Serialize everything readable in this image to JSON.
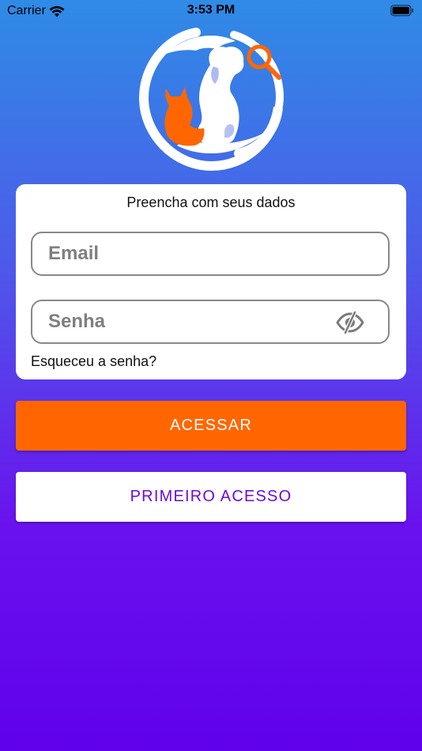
{
  "status_bar": {
    "carrier": "Carrier",
    "time": "3:53 PM",
    "wifi_icon": "wifi-icon",
    "battery_icon": "battery-icon"
  },
  "logo": {
    "icon": "pet-search-logo-icon",
    "colors": {
      "ring": "#ffffff",
      "cat": "#ff6600",
      "dog": "#ffffff",
      "magnifier": "#ff6600"
    }
  },
  "login_card": {
    "title": "Preencha com seus dados",
    "email": {
      "value": "",
      "placeholder": "Email"
    },
    "password": {
      "value": "",
      "placeholder": "Senha",
      "toggle_icon": "eye-off-icon"
    },
    "forgot_password": "Esqueceu a senha?"
  },
  "buttons": {
    "access_label": "ACESSAR",
    "first_access_label": "PRIMEIRO ACESSO"
  },
  "colors": {
    "gradient_top": "#2f8be6",
    "gradient_bottom": "#6000ec",
    "primary_orange": "#ff6600",
    "secondary_text": "#6a0dd9"
  }
}
